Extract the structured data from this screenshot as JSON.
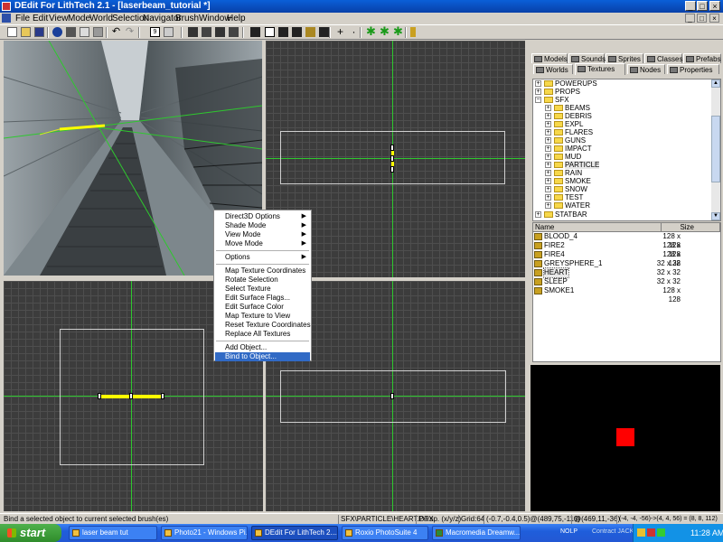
{
  "window": {
    "title": "DEdit For LithTech 2.1 - [laserbeam_tutorial *]"
  },
  "menu": {
    "items": [
      "File",
      "Edit",
      "View",
      "Mode",
      "World",
      "Selection",
      "Navigator",
      "Brush",
      "Window",
      "Help"
    ]
  },
  "context_menu": {
    "items": [
      "Direct3D Options",
      "Shade Mode",
      "View Mode",
      "Move Mode",
      "Options",
      "Map Texture Coordinates",
      "Rotate Selection",
      "Select Texture",
      "Edit Surface Flags...",
      "Edit Surface Color",
      "Map Texture to View",
      "Reset Texture Coordinates",
      "Replace All Textures",
      "Add Object...",
      "Bind to Object..."
    ],
    "selected": "Bind to Object..."
  },
  "panel": {
    "tabs_row1": [
      "Models",
      "Sounds",
      "Sprites",
      "Classes",
      "Prefabs"
    ],
    "tabs_row2": [
      "Worlds",
      "Textures",
      "Nodes",
      "Properties"
    ],
    "active_tab": "Textures",
    "tree": [
      "POWERUPS",
      "PROPS",
      "SFX",
      "BEAMS",
      "DEBRIS",
      "EXPL",
      "FLARES",
      "GUNS",
      "IMPACT",
      "MUD",
      "PARTICLE",
      "RAIN",
      "SMOKE",
      "SNOW",
      "TEST",
      "WATER",
      "STATBAR"
    ],
    "list_headers": {
      "name": "Name",
      "size": "Size"
    },
    "textures": [
      {
        "name": "BLOOD_4",
        "size": "128 x 128"
      },
      {
        "name": "FIRE2",
        "size": "128 x 128"
      },
      {
        "name": "FIRE4",
        "size": "128 x 128"
      },
      {
        "name": "GREYSPHERE_1",
        "size": "32 x 32"
      },
      {
        "name": "HEART",
        "size": "32 x 32"
      },
      {
        "name": "SLEEP",
        "size": "32 x 32"
      },
      {
        "name": "SMOKE1",
        "size": "128 x 128"
      }
    ],
    "preview_color": "#ff0000"
  },
  "status": {
    "message": "Bind a selected object to current selected brush(es)",
    "texture": "SFX\\PARTICLE\\HEART.DTX",
    "view": "Persp. (x/y/z)",
    "grid": "Grid:64",
    "coords1": "(-0.7,-0.4,0.5)@(489,75,-110)",
    "coords2": "@(469,11,-36)",
    "coords3": "(-4, -4, -56)->(4, 4, 56) = (8, 8, 112)"
  },
  "taskbar": {
    "start": "start",
    "tasks": [
      "laser beam tut",
      "Photo21 - Windows Pi...",
      "DEdit For LithTech 2....",
      "Roxio PhotoSuite 4",
      "Macromedia Dreamw..."
    ],
    "tray_text": "NOLP",
    "contract": "Contract JACK",
    "time": "11:28 AM"
  },
  "colors": {
    "accent": "#316ac5",
    "grid_line": "#2ec82e",
    "selected_beam": "#ffff00"
  }
}
